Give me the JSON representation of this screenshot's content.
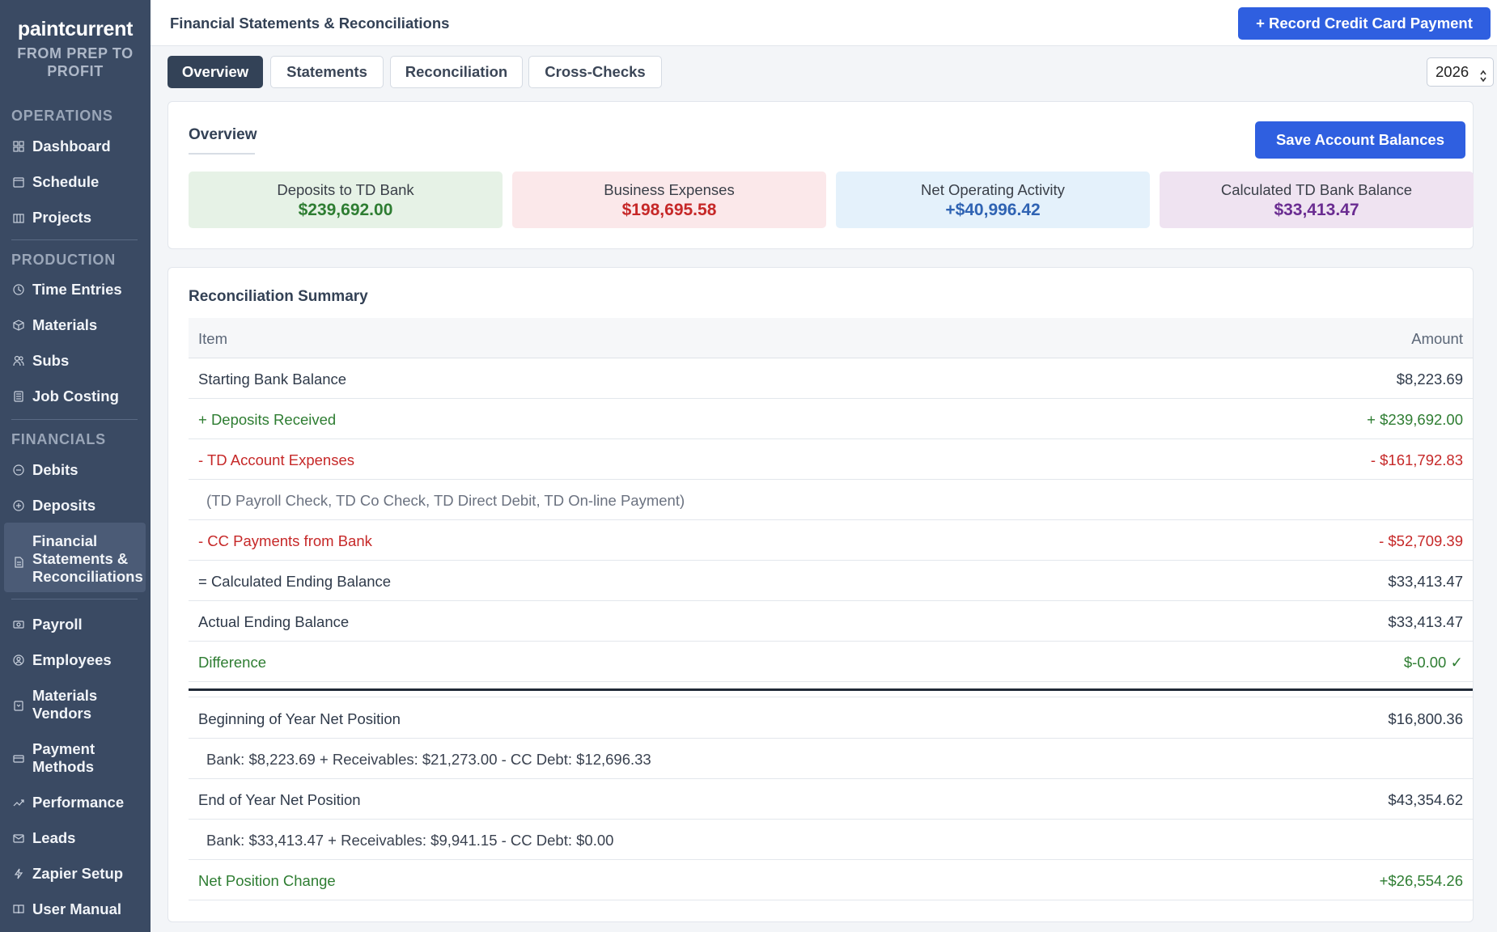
{
  "brand": {
    "name": "paintcurrent",
    "tagline_1": "FROM PREP TO",
    "tagline_2": "PROFIT"
  },
  "sidebar": {
    "sections": {
      "operations": "OPERATIONS",
      "production": "PRODUCTION",
      "financials": "FINANCIALS"
    },
    "items": {
      "dashboard": "Dashboard",
      "schedule": "Schedule",
      "projects": "Projects",
      "time_entries": "Time Entries",
      "materials": "Materials",
      "subs": "Subs",
      "job_costing": "Job Costing",
      "debits": "Debits",
      "deposits": "Deposits",
      "financial_1": "Financial",
      "financial_2": "Statements &",
      "financial_3": "Reconciliations",
      "payroll": "Payroll",
      "employees": "Employees",
      "materials_vendors_1": "Materials",
      "materials_vendors_2": "Vendors",
      "payment_methods_1": "Payment",
      "payment_methods_2": "Methods",
      "performance": "Performance",
      "leads": "Leads",
      "zapier": "Zapier Setup",
      "manual": "User Manual"
    }
  },
  "header": {
    "title": "Financial Statements & Reconciliations",
    "record_button": "+ Record Credit Card Payment"
  },
  "tabs": {
    "overview": "Overview",
    "statements": "Statements",
    "reconciliation": "Reconciliation",
    "cross_checks": "Cross-Checks"
  },
  "year": "2026",
  "overview": {
    "heading": "Overview",
    "save_button": "Save Account Balances",
    "stats": {
      "deposits": {
        "label": "Deposits to TD Bank",
        "value": "$239,692.00"
      },
      "expenses": {
        "label": "Business Expenses",
        "value": "$198,695.58"
      },
      "net_operating": {
        "label": "Net Operating Activity",
        "value": "+$40,996.42"
      },
      "calculated": {
        "label": "Calculated TD Bank Balance",
        "value": "$33,413.47"
      }
    }
  },
  "recon": {
    "title": "Reconciliation Summary",
    "header": {
      "item": "Item",
      "amount": "Amount"
    },
    "rows": {
      "starting": {
        "label": "Starting Bank Balance",
        "amount": "$8,223.69"
      },
      "deposits": {
        "label": "+ Deposits Received",
        "amount": "+ $239,692.00"
      },
      "td_expenses": {
        "label": "- TD Account Expenses",
        "amount": "- $161,792.83"
      },
      "td_note": {
        "label": "(TD Payroll Check, TD Co Check, TD Direct Debit, TD On-line Payment)"
      },
      "cc_payments": {
        "label": "- CC Payments from Bank",
        "amount": "- $52,709.39"
      },
      "calc_ending": {
        "label": "= Calculated Ending Balance",
        "amount": "$33,413.47"
      },
      "actual_ending": {
        "label": "Actual Ending Balance",
        "amount": "$33,413.47"
      },
      "difference": {
        "label": "Difference",
        "amount": "$-0.00 ✓"
      },
      "boy": {
        "label": "Beginning of Year Net Position",
        "amount": "$16,800.36"
      },
      "boy_note": {
        "label": "Bank: $8,223.69 + Receivables: $21,273.00 - CC Debt: $12,696.33"
      },
      "eoy": {
        "label": "End of Year Net Position",
        "amount": "$43,354.62"
      },
      "eoy_note": {
        "label": "Bank: $33,413.47 + Receivables: $9,941.15 - CC Debt: $0.00"
      },
      "change": {
        "label": "Net Position Change",
        "amount": "+$26,554.26"
      }
    }
  },
  "colors": {
    "sidebar": "#3a4a63",
    "primary": "#2f5fe0",
    "green": "#2e7d32",
    "red": "#c62828",
    "blue": "#2f63b3",
    "purple": "#6a2c91"
  }
}
